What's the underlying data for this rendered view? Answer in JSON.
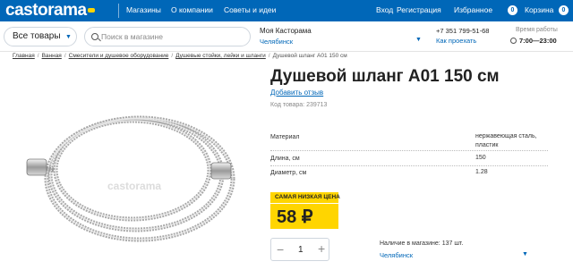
{
  "topbar": {
    "logo": "castorama",
    "nav": [
      "Магазины",
      "О компании",
      "Советы и идеи"
    ],
    "login": "Вход",
    "register": "Регистрация",
    "favorites_label": "Избранное",
    "favorites_count": "0",
    "cart_label": "Корзина",
    "cart_count": "0",
    "accent_color": "#0067b8",
    "brand_yellow": "#ffd500"
  },
  "header": {
    "catalog_button": "Все товары",
    "search_placeholder": "Поиск в магазине",
    "store_name": "Моя Касторама",
    "store_city": "Челябинск",
    "phone": "+7 351 799-51-68",
    "route_link": "Как проехать",
    "hours_label": "Время работы",
    "hours": "7:00—23:00"
  },
  "breadcrumbs": [
    "Главная",
    "Ванная",
    "Смесители и душевое оборудование",
    "Душевые стойки, лейки и шланги",
    "Душевой шланг A01 150 см"
  ],
  "product": {
    "title": "Душевой шланг A01 150 см",
    "review_link": "Добавить отзыв",
    "code": "Код товара: 239713",
    "watermark": "castorama",
    "specs": [
      {
        "label": "Материал",
        "value": "нержавеющая сталь, пластик"
      },
      {
        "label": "Длина, см",
        "value": "150"
      },
      {
        "label": "Диаметр, см",
        "value": "1.28"
      }
    ],
    "price_label": "САМАЯ НИЗКАЯ ЦЕНА",
    "price": "58 ₽",
    "quantity": "1",
    "qty_minus": "−",
    "qty_plus": "+",
    "stock_text": "Наличие в магазине: 137 шт.",
    "stock_city": "Челябинск"
  }
}
